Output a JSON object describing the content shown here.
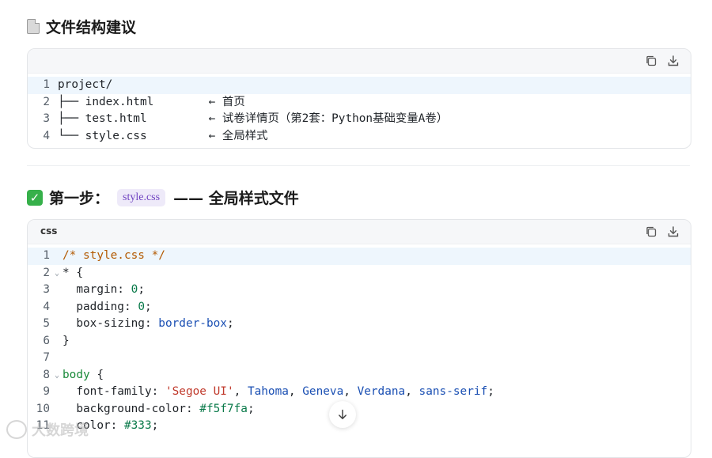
{
  "section1": {
    "title": "文件结构建议",
    "icon": "document-icon",
    "code_lines": [
      {
        "n": "1",
        "text": "project/"
      },
      {
        "n": "2",
        "text": "├── index.html        ← 首页"
      },
      {
        "n": "3",
        "text": "├── test.html         ← 试卷详情页（第2套：Python基础变量A卷）"
      },
      {
        "n": "4",
        "text": "└── style.css         ← 全局样式"
      }
    ]
  },
  "section2": {
    "title_prefix": "第一步：",
    "inline_code": "style.css",
    "title_suffix": "—— 全局样式文件",
    "icon": "check-icon",
    "lang": "css"
  },
  "css_code": {
    "l1": {
      "n": "1",
      "comment": "/* style.css */"
    },
    "l2": {
      "n": "2",
      "sel": "* {"
    },
    "l3": {
      "n": "3",
      "prop": "margin: ",
      "val": "0",
      "end": ";"
    },
    "l4": {
      "n": "4",
      "prop": "padding: ",
      "val": "0",
      "end": ";"
    },
    "l5": {
      "n": "5",
      "prop": "box-sizing: ",
      "val": "border-box",
      "end": ";"
    },
    "l6": {
      "n": "6",
      "text": "}"
    },
    "l7": {
      "n": "7",
      "text": ""
    },
    "l8": {
      "n": "8",
      "sel": "body",
      "rest": " {"
    },
    "l9": {
      "n": "9",
      "prop": "font-family: ",
      "s1": "'Segoe UI'",
      "rest": ", ",
      "k1": "Tahoma",
      "c1": ", ",
      "k2": "Geneva",
      "c2": ", ",
      "k3": "Verdana",
      "c3": ", ",
      "k4": "sans-serif",
      "end": ";"
    },
    "l10": {
      "n": "10",
      "prop": "background-color: ",
      "val": "#f5f7fa",
      "end": ";"
    },
    "l11": {
      "n": "11",
      "prop": "color: ",
      "val": "#333",
      "end": ";"
    }
  },
  "watermark": "大数跨境"
}
